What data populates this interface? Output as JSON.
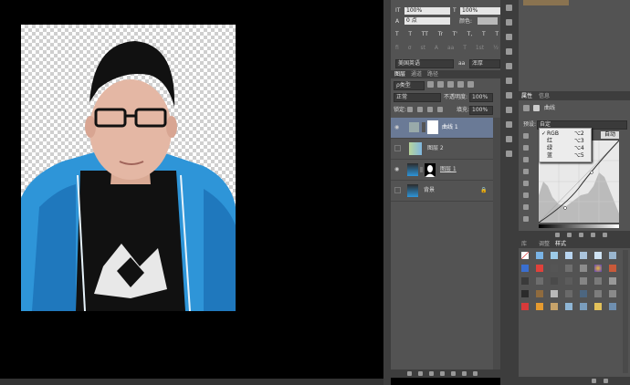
{
  "character_panel": {
    "leading_value": "100%",
    "tracking_value": "100%",
    "color_label": "颜色:",
    "language": "美国英语",
    "antialias": "浑厚",
    "style_buttons": [
      "T",
      "T",
      "TT",
      "Tr",
      "T'",
      "T,",
      "T",
      "T"
    ],
    "ligature_buttons": [
      "fi",
      "σ",
      "st",
      "A",
      "aa",
      "T",
      "1st",
      "½"
    ]
  },
  "layers_panel": {
    "tabs": [
      "图层",
      "通道",
      "路径"
    ],
    "filter_label": "ρ类型",
    "blend_mode": "正常",
    "opacity_label": "不透明度:",
    "opacity_value": "100%",
    "lock_label": "锁定:",
    "fill_label": "填充:",
    "fill_value": "100%",
    "layers": [
      {
        "name": "曲线 1",
        "selected": true,
        "visible": true
      },
      {
        "name": "图层 2",
        "selected": false,
        "visible": false
      },
      {
        "name": "图层 1",
        "selected": false,
        "visible": true
      },
      {
        "name": "背景",
        "selected": false,
        "visible": false
      }
    ]
  },
  "properties_panel": {
    "tabs": [
      "属性",
      "信息"
    ],
    "title": "曲线",
    "preset_label": "预设:",
    "preset_value": "自定",
    "channel_menu": [
      {
        "label": "RGB",
        "shortcut": "⌥2",
        "checked": true
      },
      {
        "label": "红",
        "shortcut": "⌥3",
        "checked": false
      },
      {
        "label": "绿",
        "shortcut": "⌥4",
        "checked": false
      },
      {
        "label": "蓝",
        "shortcut": "⌥5",
        "checked": false
      }
    ],
    "auto_button": "自动",
    "colors": {
      "curve": "#2d2d2d",
      "histogram": "#bbbbbb"
    }
  },
  "styles_panel": {
    "tabs": [
      "库",
      "调整",
      "样式"
    ]
  }
}
